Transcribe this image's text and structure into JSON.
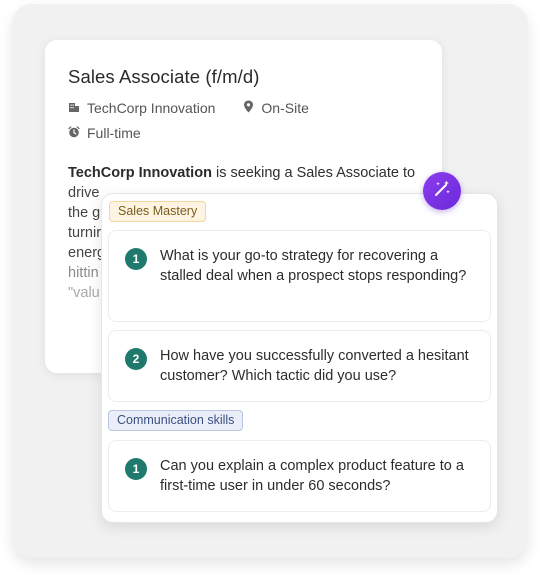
{
  "job": {
    "title": "Sales Associate (f/m/d)",
    "company": "TechCorp Innovation",
    "location": "On-Site",
    "employment_type": "Full-time",
    "icons": {
      "company": "building-icon",
      "location": "location-pin-icon",
      "type": "clock-icon"
    },
    "description": {
      "company": "TechCorp Innovation",
      "line1_rest": " is seeking a Sales Associate to",
      "line2": "drive",
      "line3": "the g",
      "line4": "turnir",
      "line5": "energ",
      "line6": "hittin",
      "line7": "\"valu"
    }
  },
  "questions_panel": {
    "magic_icon": "magic-wand-icon",
    "accent": "#7a33e6",
    "groups": [
      {
        "tag": "Sales Mastery",
        "questions": [
          {
            "number": "1",
            "text": "What is your go-to strategy for recovering a stalled deal when a prospect stops responding?"
          },
          {
            "number": "2",
            "text": "How have you successfully converted a hesitant customer? Which tactic did you use?"
          }
        ]
      },
      {
        "tag": "Communication skills",
        "questions": [
          {
            "number": "1",
            "text": "Can you explain a complex product feature to a first-time user in under 60 seconds?"
          }
        ]
      }
    ]
  },
  "colors": {
    "number_badge": "#1f7a6d",
    "sales_tag_bg": "#fdf4e2",
    "communication_tag_bg": "#e9eef8"
  }
}
